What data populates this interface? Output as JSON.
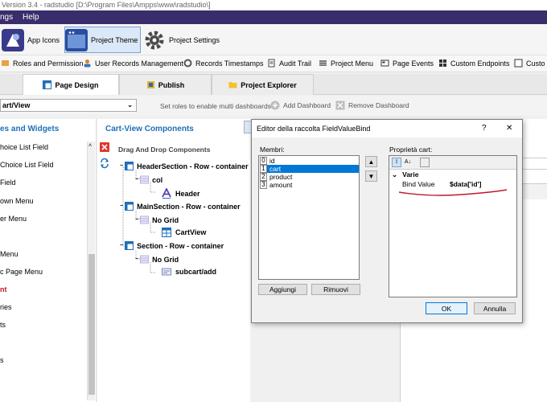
{
  "window": {
    "title": "Version 3.4 - radstudio [D:\\Program Files\\Ampps\\www\\radstudio\\]"
  },
  "menu": {
    "items": [
      "ngs",
      "Help"
    ]
  },
  "toolbar1": {
    "app_icons": "App Icons",
    "project_theme": "Project Theme",
    "project_settings": "Project Settings"
  },
  "toolbar2": {
    "roles": "Roles and Permission",
    "user_records": "User Records Management",
    "records_timestamps": "Records Timestamps",
    "audit_trail": "Audit Trail",
    "project_menu": "Project Menu",
    "page_events": "Page Events",
    "custom_endpoints": "Custom Endpoints",
    "custom_more": "Custo"
  },
  "tabs": {
    "page_design": "Page Design",
    "publish": "Publish",
    "project_explorer": "Project Explorer"
  },
  "dashboard": {
    "select_value": "art/View",
    "hint": "Set roles to enable multi dashboards",
    "add": "Add Dashboard",
    "remove": "Remove Dashboard"
  },
  "left": {
    "header": "es and Widgets",
    "items": [
      "hoice List Field",
      "Choice List Field",
      "Field",
      "own Menu",
      "er Menu",
      "",
      "Menu",
      "c Page Menu",
      "nt",
      "ries",
      "ts",
      "",
      "s"
    ]
  },
  "center": {
    "title": "Cart-View Components",
    "drag_drop": "Drag And Drop Components",
    "tree": {
      "header_section": "HeaderSection - Row - container",
      "col": "col",
      "header": "Header",
      "main_section": "MainSection - Row - container",
      "no_grid_1": "No Grid",
      "cartview": "CartView",
      "section": "Section - Row - container",
      "no_grid_2": "No Grid",
      "subcart_add": "subcart/add"
    }
  },
  "dialog": {
    "title": "Editor della raccolta FieldValueBind",
    "help": "?",
    "close": "✕",
    "members_label": "Membri:",
    "members": [
      {
        "idx": "0",
        "name": "id"
      },
      {
        "idx": "1",
        "name": "cart"
      },
      {
        "idx": "2",
        "name": "product"
      },
      {
        "idx": "3",
        "name": "amount"
      }
    ],
    "props_label": "Proprietà cart:",
    "category": "Varie",
    "prop_name": "Bind Value",
    "prop_value": "$data['id']",
    "add_btn": "Aggiungi",
    "remove_btn": "Rimuovi",
    "ok_btn": "OK",
    "cancel_btn": "Annulla"
  },
  "colors": {
    "menubar": "#3a2d6b",
    "accent": "#1e6fb8",
    "selection": "#0078d7",
    "annotation": "#c0192b"
  }
}
